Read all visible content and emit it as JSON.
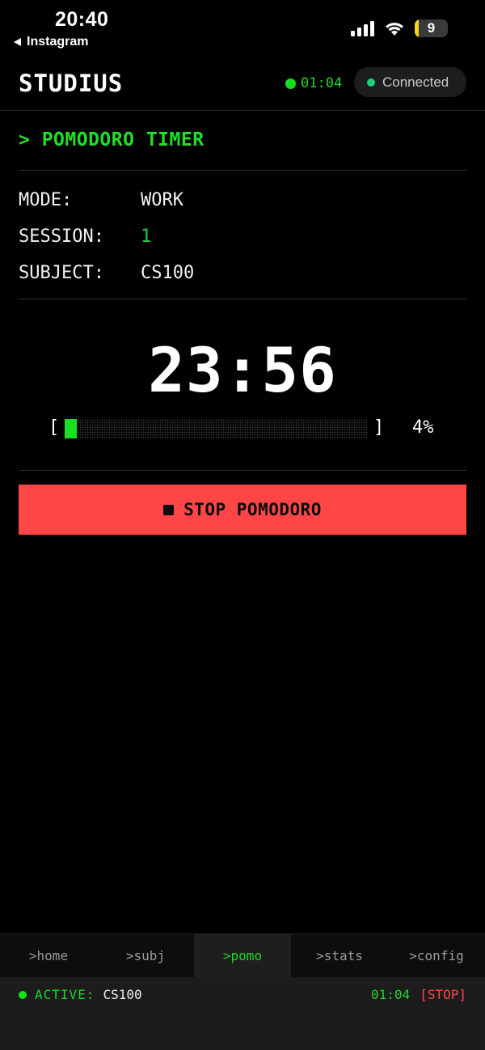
{
  "status_bar": {
    "time": "20:40",
    "back_label": "Instagram",
    "battery": "9",
    "colors": {
      "battery_fill": "#f7d31c"
    }
  },
  "header": {
    "brand": "STUDIUS",
    "timer": "01:04",
    "connection": "Connected"
  },
  "section": {
    "title": "> POMODORO TIMER"
  },
  "info": [
    {
      "label": "MODE:",
      "value": "WORK"
    },
    {
      "label": "SESSION:",
      "value": "1"
    },
    {
      "label": "SUBJECT:",
      "value": "CS100"
    }
  ],
  "timer": {
    "display": "23:56",
    "bracket_left": "[",
    "bracket_right": "]",
    "progress_percent": 4,
    "progress_label": "4%"
  },
  "actions": {
    "stop_label": "STOP POMODORO"
  },
  "nav": {
    "items": [
      {
        "label": ">home",
        "active": false
      },
      {
        "label": ">subj",
        "active": false
      },
      {
        "label": ">pomo",
        "active": true
      },
      {
        "label": ">stats",
        "active": false
      },
      {
        "label": ">config",
        "active": false
      }
    ]
  },
  "footer": {
    "active_label": "ACTIVE:",
    "active_subject": "CS100",
    "time": "01:04",
    "stop_label": "[STOP]"
  },
  "colors": {
    "accent_green": "#20d42b",
    "danger_red": "#ff4646",
    "background": "#000000"
  }
}
